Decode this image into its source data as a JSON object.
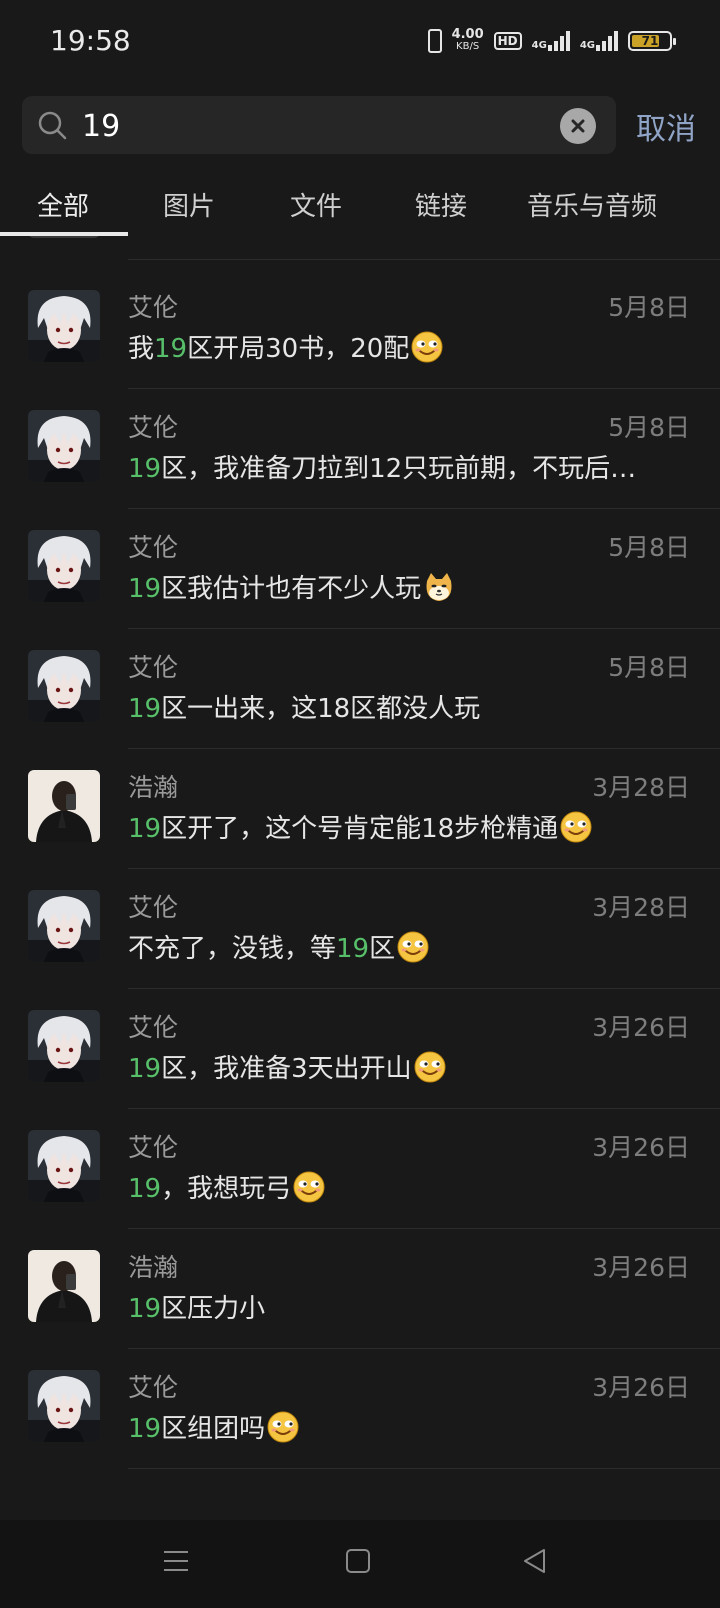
{
  "status": {
    "time": "19:58",
    "net_speed": "4.00",
    "net_unit": "KB/S",
    "hd": "HD",
    "sim1": "4G",
    "sim2": "4G",
    "battery": "71"
  },
  "search": {
    "query": "19",
    "cancel_label": "取消"
  },
  "tabs": [
    {
      "label": "全部",
      "active": true
    },
    {
      "label": "图片"
    },
    {
      "label": "文件"
    },
    {
      "label": "链接"
    },
    {
      "label": "音乐与音频"
    }
  ],
  "results": [
    {
      "name": "艾伦",
      "date": "5月8日",
      "avatar": "ghoul",
      "before": "我",
      "match": "19",
      "after": "区开局30书，20配",
      "emoji": "smirk"
    },
    {
      "name": "艾伦",
      "date": "5月8日",
      "avatar": "ghoul",
      "before": "",
      "match": "19",
      "after": "区，我准备刀拉到12只玩前期，不玩后…",
      "emoji": ""
    },
    {
      "name": "艾伦",
      "date": "5月8日",
      "avatar": "ghoul",
      "before": "",
      "match": "19",
      "after": "区我估计也有不少人玩",
      "emoji": "doge"
    },
    {
      "name": "艾伦",
      "date": "5月8日",
      "avatar": "ghoul",
      "before": "",
      "match": "19",
      "after": "区一出来，这18区都没人玩",
      "emoji": ""
    },
    {
      "name": "浩瀚",
      "date": "3月28日",
      "avatar": "person",
      "before": "",
      "match": "19",
      "after": "区开了，这个号肯定能18步枪精通",
      "emoji": "smirk"
    },
    {
      "name": "艾伦",
      "date": "3月28日",
      "avatar": "ghoul",
      "before": "不充了，没钱，等",
      "match": "19",
      "after": "区",
      "emoji": "smirk"
    },
    {
      "name": "艾伦",
      "date": "3月26日",
      "avatar": "ghoul",
      "before": "",
      "match": "19",
      "after": "区，我准备3天出开山",
      "emoji": "smirk"
    },
    {
      "name": "艾伦",
      "date": "3月26日",
      "avatar": "ghoul",
      "before": "",
      "match": "19",
      "after": "，我想玩弓",
      "emoji": "smirk"
    },
    {
      "name": "浩瀚",
      "date": "3月26日",
      "avatar": "person",
      "before": "",
      "match": "19",
      "after": "区压力小",
      "emoji": ""
    },
    {
      "name": "艾伦",
      "date": "3月26日",
      "avatar": "ghoul",
      "before": "",
      "match": "19",
      "after": "区组团吗",
      "emoji": "smirk"
    }
  ],
  "colors": {
    "background": "#191919",
    "highlight": "#57be6a",
    "cancel": "#8fa4c6",
    "name": "#9a9a9a",
    "date": "#7d7d7d"
  },
  "nav": [
    "menu-icon",
    "home-square-icon",
    "back-triangle-icon"
  ]
}
